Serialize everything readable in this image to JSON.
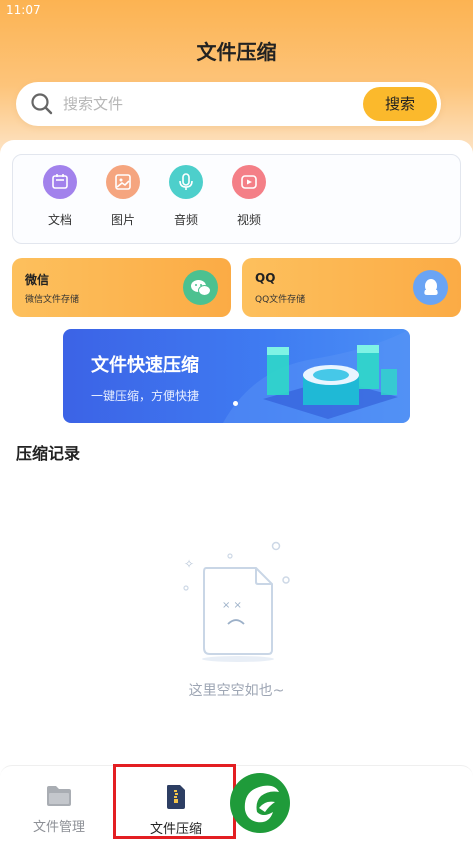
{
  "status_bar": {
    "time": "11:07"
  },
  "header": {
    "title": "文件压缩"
  },
  "search": {
    "placeholder": "搜索文件",
    "button_label": "搜索"
  },
  "categories": [
    {
      "label": "文档",
      "icon": "document-icon",
      "color": "#a282ec"
    },
    {
      "label": "图片",
      "icon": "image-icon",
      "color": "#f5a57f"
    },
    {
      "label": "音频",
      "icon": "microphone-icon",
      "color": "#4dcfcb"
    },
    {
      "label": "视频",
      "icon": "video-icon",
      "color": "#f47f87"
    }
  ],
  "features": [
    {
      "title": "微信",
      "subtitle": "微信文件存储",
      "icon": "wechat-icon",
      "icon_color": "#4cc190"
    },
    {
      "title": "QQ",
      "subtitle": "QQ文件存储",
      "icon": "qq-icon",
      "icon_color": "#6aa4f4"
    }
  ],
  "banner": {
    "title": "文件快速压缩",
    "subtitle": "一键压缩，方便快捷"
  },
  "records": {
    "section_title": "压缩记录",
    "empty_text": "这里空空如也~"
  },
  "bottom_nav": [
    {
      "label": "文件管理",
      "icon": "folder-icon",
      "active": false
    },
    {
      "label": "文件压缩",
      "icon": "zip-file-icon",
      "active": true
    }
  ],
  "colors": {
    "accent": "#fbb92c",
    "banner_blue": "#3f6ff0",
    "highlight_red": "#e31e22"
  }
}
